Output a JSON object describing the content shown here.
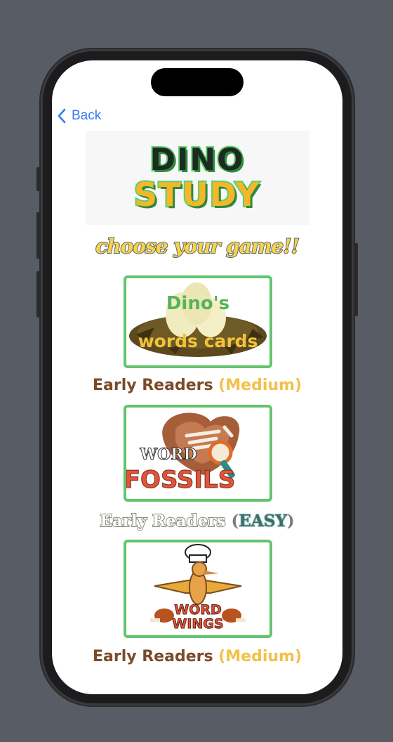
{
  "nav": {
    "back_label": "Back"
  },
  "logo": {
    "line1": "DINO",
    "line2": "STUDY"
  },
  "tagline": "choose your game!!",
  "games": [
    {
      "image_title_top": "Dino's",
      "image_title_bottom": "words cards",
      "caption_main": "Early Readers ",
      "caption_level": "(Medium)"
    },
    {
      "image_title_top": "WORD",
      "image_title_bottom": "FOSSILS",
      "caption_main": "Early Readers ",
      "caption_level": "EASY",
      "caption_paren_open": "(",
      "caption_paren_close": ")"
    },
    {
      "image_title_top": "WORD",
      "image_title_bottom": "WINGS",
      "caption_main": "Early Readers ",
      "caption_level": "(Medium)"
    }
  ],
  "colors": {
    "accent_blue": "#3478f6",
    "card_border": "#63c46d",
    "caption_brown": "#7b4b2a",
    "caption_gold": "#f2c14a"
  }
}
